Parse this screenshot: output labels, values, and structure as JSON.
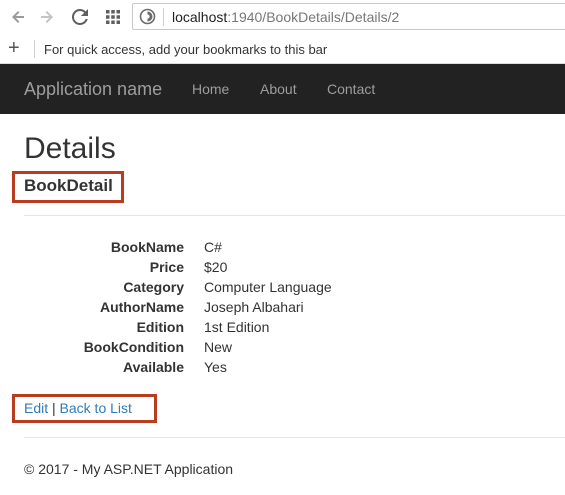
{
  "browser": {
    "icons": {
      "back": "back-arrow-icon",
      "forward": "forward-arrow-icon",
      "reload": "reload-icon",
      "apps": "apps-grid-icon",
      "site_info": "site-info-icon",
      "add_bookmark": "plus-icon"
    },
    "url_host": "localhost",
    "url_path": ":1940/BookDetails/Details/2",
    "bookmarks_plus": "+",
    "bookmarks_hint": "For quick access, add your bookmarks to this bar"
  },
  "navbar": {
    "brand": "Application name",
    "links": [
      "Home",
      "About",
      "Contact"
    ]
  },
  "page": {
    "title": "Details",
    "subtitle": "BookDetail",
    "fields": [
      {
        "label": "BookName",
        "value": "C#"
      },
      {
        "label": "Price",
        "value": "$20"
      },
      {
        "label": "Category",
        "value": "Computer Language"
      },
      {
        "label": "AuthorName",
        "value": "Joseph Albahari"
      },
      {
        "label": "Edition",
        "value": "1st Edition"
      },
      {
        "label": "BookCondition",
        "value": "New"
      },
      {
        "label": "Available",
        "value": "Yes"
      }
    ],
    "edit_link": "Edit",
    "separator": "|",
    "back_link": "Back to List",
    "footer": "© 2017 - My ASP.NET Application"
  },
  "colors": {
    "navbar_bg": "#222222",
    "navbar_text": "#9d9d9d",
    "link": "#337ab7",
    "highlight_box": "#b83c1d"
  }
}
